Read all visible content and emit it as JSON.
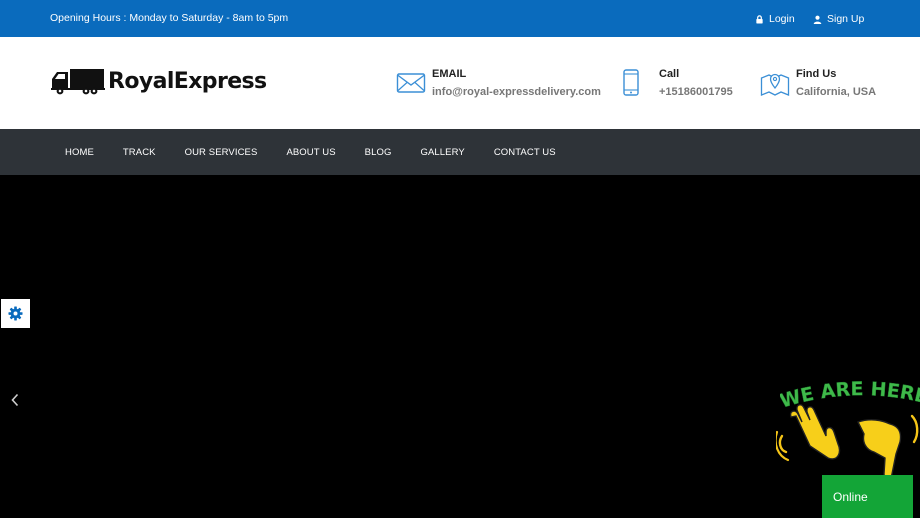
{
  "topbar": {
    "hours": "Opening Hours : Monday to Saturday - 8am to 5pm",
    "login_label": "Login",
    "signup_label": "Sign Up"
  },
  "header": {
    "logo_text": "RoyalExpress",
    "email_title": "EMAIL",
    "email_value": "info@royal-expressdelivery.com",
    "call_title": "Call",
    "call_value": "+15186001795",
    "find_title": "Find Us",
    "find_value": "California, USA"
  },
  "nav": {
    "items": [
      "HOME",
      "TRACK",
      "OUR SERVICES",
      "ABOUT US",
      "BLOG",
      "GALLERY",
      "CONTACT US"
    ]
  },
  "widget": {
    "banner_text": "WE ARE HERE!",
    "status_label": "Online"
  },
  "colors": {
    "topbar": "#0a6bbd",
    "nav": "#2e3338",
    "accent": "#3b8fd6",
    "online": "#13a537",
    "banner": "#3fb94a"
  },
  "icons": [
    "lock-icon",
    "user-icon",
    "truck-logo-icon",
    "envelope-icon",
    "phone-icon",
    "map-icon",
    "gear-icon",
    "chevron-left-icon",
    "waving-hand-icon",
    "pointing-hand-icon"
  ]
}
